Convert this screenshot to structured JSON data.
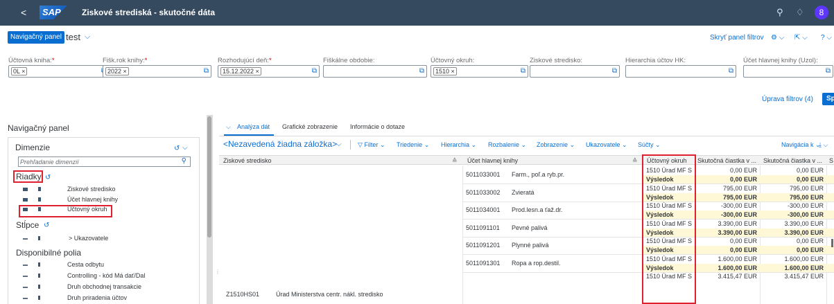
{
  "shell": {
    "back": "<",
    "logo": "SAP",
    "title": "Ziskové strediská - skutočné dáta",
    "search_icon": "🔍",
    "bell_icon": "🔔",
    "avatar": "8"
  },
  "variant": {
    "nav_button": "Navigačný panel",
    "name": "test",
    "chevron": "⌵"
  },
  "toolbar": {
    "hide_filter_bar": "Skryť panel filtrov",
    "settings": "⚙ ⌵",
    "share": "⇱ ⌵",
    "help": "? ⌵"
  },
  "filters": [
    {
      "label": "Účtovná kniha:",
      "required": true,
      "token": "0L ×"
    },
    {
      "label": "Fišk.rok knihy:",
      "required": true,
      "token": "2022 ×"
    },
    {
      "label": "Rozhodujúcí deň:",
      "required": true,
      "token": "15.12.2022 ×"
    },
    {
      "label": "Fiškálne obdobie:",
      "required": false,
      "token": ""
    },
    {
      "label": "Účtovný okruh:",
      "required": false,
      "token": "1510 ×"
    },
    {
      "label": "Ziskové stredisko:",
      "required": false,
      "token": ""
    },
    {
      "label": "Hierarchia účtov HK:",
      "required": false,
      "token": ""
    },
    {
      "label": "Účet hlavnej knihy (Uzol):",
      "required": false,
      "token": ""
    }
  ],
  "required_mark": "*",
  "value_help_icon": "⧉",
  "filter_actions": {
    "adapt": "Úprava filtrov (4)",
    "go": "Spustenie"
  },
  "nav_panel": {
    "title": "Navigačný panel",
    "dimensions_title": "Dimenzie",
    "dim_menu": "⌵",
    "search_placeholder": "Prehľadanie dimenzií",
    "rows_title": "Riadky",
    "rows": [
      "Ziskové stredisko",
      "Účet hlavnej knihy",
      "Účtovný okruh"
    ],
    "columns_title": "Stĺpce",
    "columns": [
      "> Ukazovatele"
    ],
    "available_title": "Disponibilné polia",
    "available": [
      "Cesta odbytu",
      "Controlling - kód Má dať/Dal",
      "Druh obchodnej transakcie",
      "Druh priradenia účtov"
    ]
  },
  "tabs": [
    "Analýza dát",
    "Grafické zobrazenie",
    "Informácie o dotaze"
  ],
  "tab_chevron": "⌵",
  "bookmark": "<Nezavedená žiadna záložka>",
  "bookmark_chev": "⌵",
  "table_toolbar": {
    "filter": "Filter",
    "sort": "Triedenie",
    "hierarchy": "Hierarchia",
    "expand": "Rozbalenie",
    "display": "Zobrazenie",
    "measures": "Ukazovatele",
    "totals": "Súčty",
    "navigate": "Navigácia k",
    "export": "⤓ ⌵"
  },
  "table": {
    "headers": [
      "Ziskové stredisko",
      "Účet hlavnej knihy",
      "Účtovný okruh",
      "Skutočná čiastka v ...",
      "Skutočná čiastka v ...",
      "S"
    ],
    "sort_icon": "≙",
    "profit_center_id": "Z1510HS01",
    "profit_center_name": "Úrad Ministerstva centr. nákl. stredisko",
    "company_code": "1510 Úrad MF S",
    "result_label": "Výsledok",
    "rows": [
      {
        "account": "5011033001",
        "account_name": "Farm., poľ.a ryb.pr.",
        "val1": "0,00 EUR",
        "val2": "0,00 EUR",
        "res1": "0,00 EUR",
        "res2": "0,00 EUR"
      },
      {
        "account": "5011033002",
        "account_name": "Zvieratá",
        "val1": "795,00 EUR",
        "val2": "795,00 EUR",
        "res1": "795,00 EUR",
        "res2": "795,00 EUR"
      },
      {
        "account": "5011034001",
        "account_name": "Prod.lesn.a ťaž.dr.",
        "val1": "-300,00 EUR",
        "val2": "-300,00 EUR",
        "res1": "-300,00 EUR",
        "res2": "-300,00 EUR"
      },
      {
        "account": "5011091101",
        "account_name": "Pevné palivá",
        "val1": "3.390,00 EUR",
        "val2": "3.390,00 EUR",
        "res1": "3.390,00 EUR",
        "res2": "3.390,00 EUR"
      },
      {
        "account": "5011091201",
        "account_name": "Plynné palivá",
        "val1": "0,00 EUR",
        "val2": "0,00 EUR",
        "res1": "0,00 EUR",
        "res2": "0,00 EUR"
      },
      {
        "account": "5011091301",
        "account_name": "Ropa a rop.destil.",
        "val1": "1.600,00 EUR",
        "val2": "1.600,00 EUR",
        "res1": "1.600,00 EUR",
        "res2": "1.600,00 EUR"
      },
      {
        "account": "",
        "account_name": "",
        "val1": "3.415,47 EUR",
        "val2": "3.415,47 EUR",
        "res1": "",
        "res2": ""
      }
    ]
  },
  "colors": {
    "shell": "#354a5f",
    "accent": "#0a6ed1",
    "highlight": "#e0202f",
    "result_row": "#fff8d6"
  }
}
